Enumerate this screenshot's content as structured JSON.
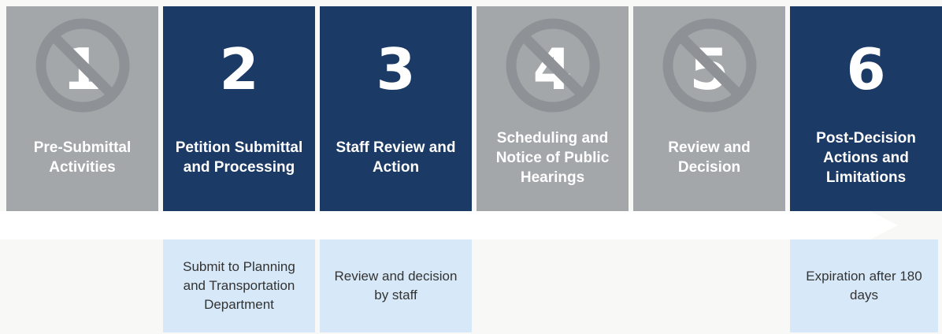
{
  "steps": [
    {
      "number": "1",
      "label": "Pre-Submittal Activities",
      "style": "gray",
      "not_applicable": true
    },
    {
      "number": "2",
      "label": "Petition Submittal and Processing",
      "style": "navy",
      "not_applicable": false
    },
    {
      "number": "3",
      "label": "Staff Review and Action",
      "style": "navy",
      "not_applicable": false
    },
    {
      "number": "4",
      "label": "Scheduling and Notice of Public Hearings",
      "style": "gray",
      "not_applicable": true
    },
    {
      "number": "5",
      "label": "Review and Decision",
      "style": "gray",
      "not_applicable": true
    },
    {
      "number": "6",
      "label": "Post-Decision Actions and Limitations",
      "style": "navy",
      "not_applicable": false
    }
  ],
  "details": {
    "step2": "Submit to Planning and Transportation Department",
    "step3": "Review and decision by staff",
    "step6": "Expiration after 180 days"
  },
  "colors": {
    "navy": "#1c3a66",
    "gray": "#a3a7aa",
    "detail_bg": "#d7e9f8",
    "prohibited_sign": "#8e9296"
  },
  "icons": {
    "not_applicable": "prohibited-sign-icon"
  }
}
